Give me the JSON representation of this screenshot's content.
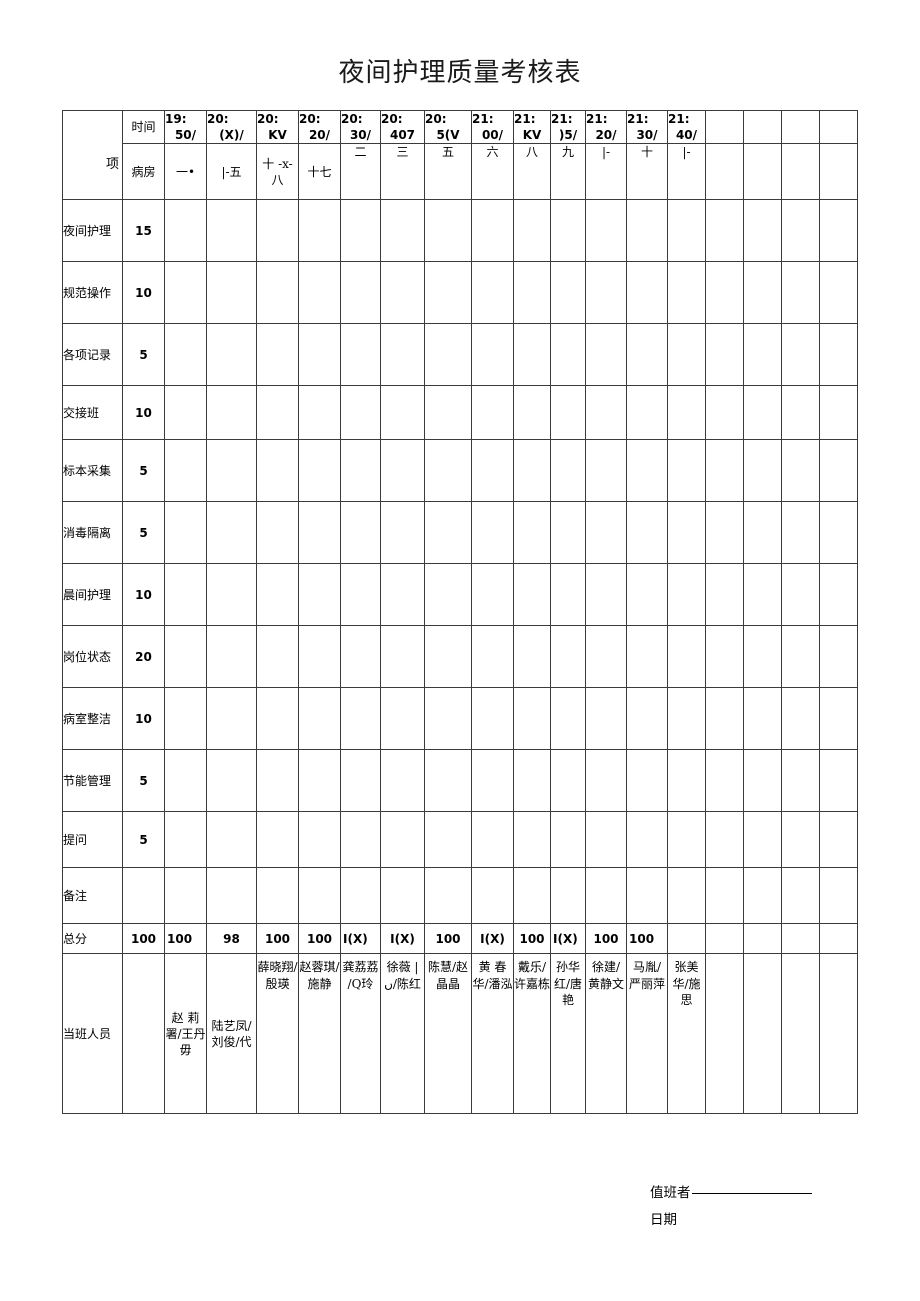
{
  "document": {
    "title": "夜间护理质量考核表"
  },
  "table": {
    "corner_label": "项",
    "row_header_time": "时间",
    "row_header_room": "病房",
    "time_headers": [
      {
        "line1": "19:",
        "line2": "50/"
      },
      {
        "line1": "20:",
        "line2": "(X)/"
      },
      {
        "line1": "20:",
        "line2": "KV"
      },
      {
        "line1": "20:",
        "line2": "20/"
      },
      {
        "line1": "20:",
        "line2": "30/"
      },
      {
        "line1": "20:",
        "line2": "407"
      },
      {
        "line1": "20:",
        "line2": "5(V"
      },
      {
        "line1": "21:",
        "line2": "00/"
      },
      {
        "line1": "21:",
        "line2": "KV"
      },
      {
        "line1": "21:",
        "line2": ")5/"
      },
      {
        "line1": "21:",
        "line2": "20/"
      },
      {
        "line1": "21:",
        "line2": "30/"
      },
      {
        "line1": "21:",
        "line2": "40/"
      },
      {
        "line1": "",
        "line2": ""
      },
      {
        "line1": "",
        "line2": ""
      },
      {
        "line1": "",
        "line2": ""
      },
      {
        "line1": "",
        "line2": ""
      },
      {
        "line1": "",
        "line2": ""
      }
    ],
    "room_headers": [
      "一•",
      "|-五",
      "十 -x-八",
      "十七",
      "二",
      "三",
      "五",
      "六",
      "八",
      "九",
      "|-",
      "十",
      "|-",
      "",
      "",
      "",
      "",
      ""
    ],
    "items": [
      {
        "name": "夜间护理",
        "score": "15"
      },
      {
        "name": "规范操作",
        "score": "10"
      },
      {
        "name": "各项记录",
        "score": "5"
      },
      {
        "name": "交接班",
        "score": "10"
      },
      {
        "name": "标本采集",
        "score": "5"
      },
      {
        "name": "消毒隔离",
        "score": "5"
      },
      {
        "name": "晨间护理",
        "score": "10"
      },
      {
        "name": "岗位状态",
        "score": "20"
      },
      {
        "name": "病室整洁",
        "score": "10"
      },
      {
        "name": "节能管理",
        "score": "5"
      },
      {
        "name": "提问",
        "score": "5"
      },
      {
        "name": "备注",
        "score": ""
      }
    ],
    "total_row": {
      "label": "总分",
      "max": "100",
      "values": [
        "100",
        "98",
        "100",
        "100",
        "I(X)",
        "I(X)",
        "100",
        "I(X)",
        "100",
        "I(X)",
        "100",
        "100",
        "",
        "",
        "",
        "",
        ""
      ]
    },
    "staff_row": {
      "label": "当班人员",
      "names": [
        "",
        "赵 莉署/王丹毋",
        "陆艺凤/刘俊/代",
        "薛晓翔/殷瑛",
        "赵蓉琪/施静",
        "龚荔荔 /Q玲",
        "徐薇 |ں/陈红",
        "陈慧/赵晶晶",
        "黄 春华/潘泓",
        "戴乐/许嘉栋",
        "孙华红/唐艳",
        "徐建/黄静文",
        "马胤/严丽萍",
        "张美华/施思",
        "",
        "",
        "",
        ""
      ]
    }
  },
  "footer": {
    "duty_label": "值班者",
    "date_label": "日期"
  }
}
